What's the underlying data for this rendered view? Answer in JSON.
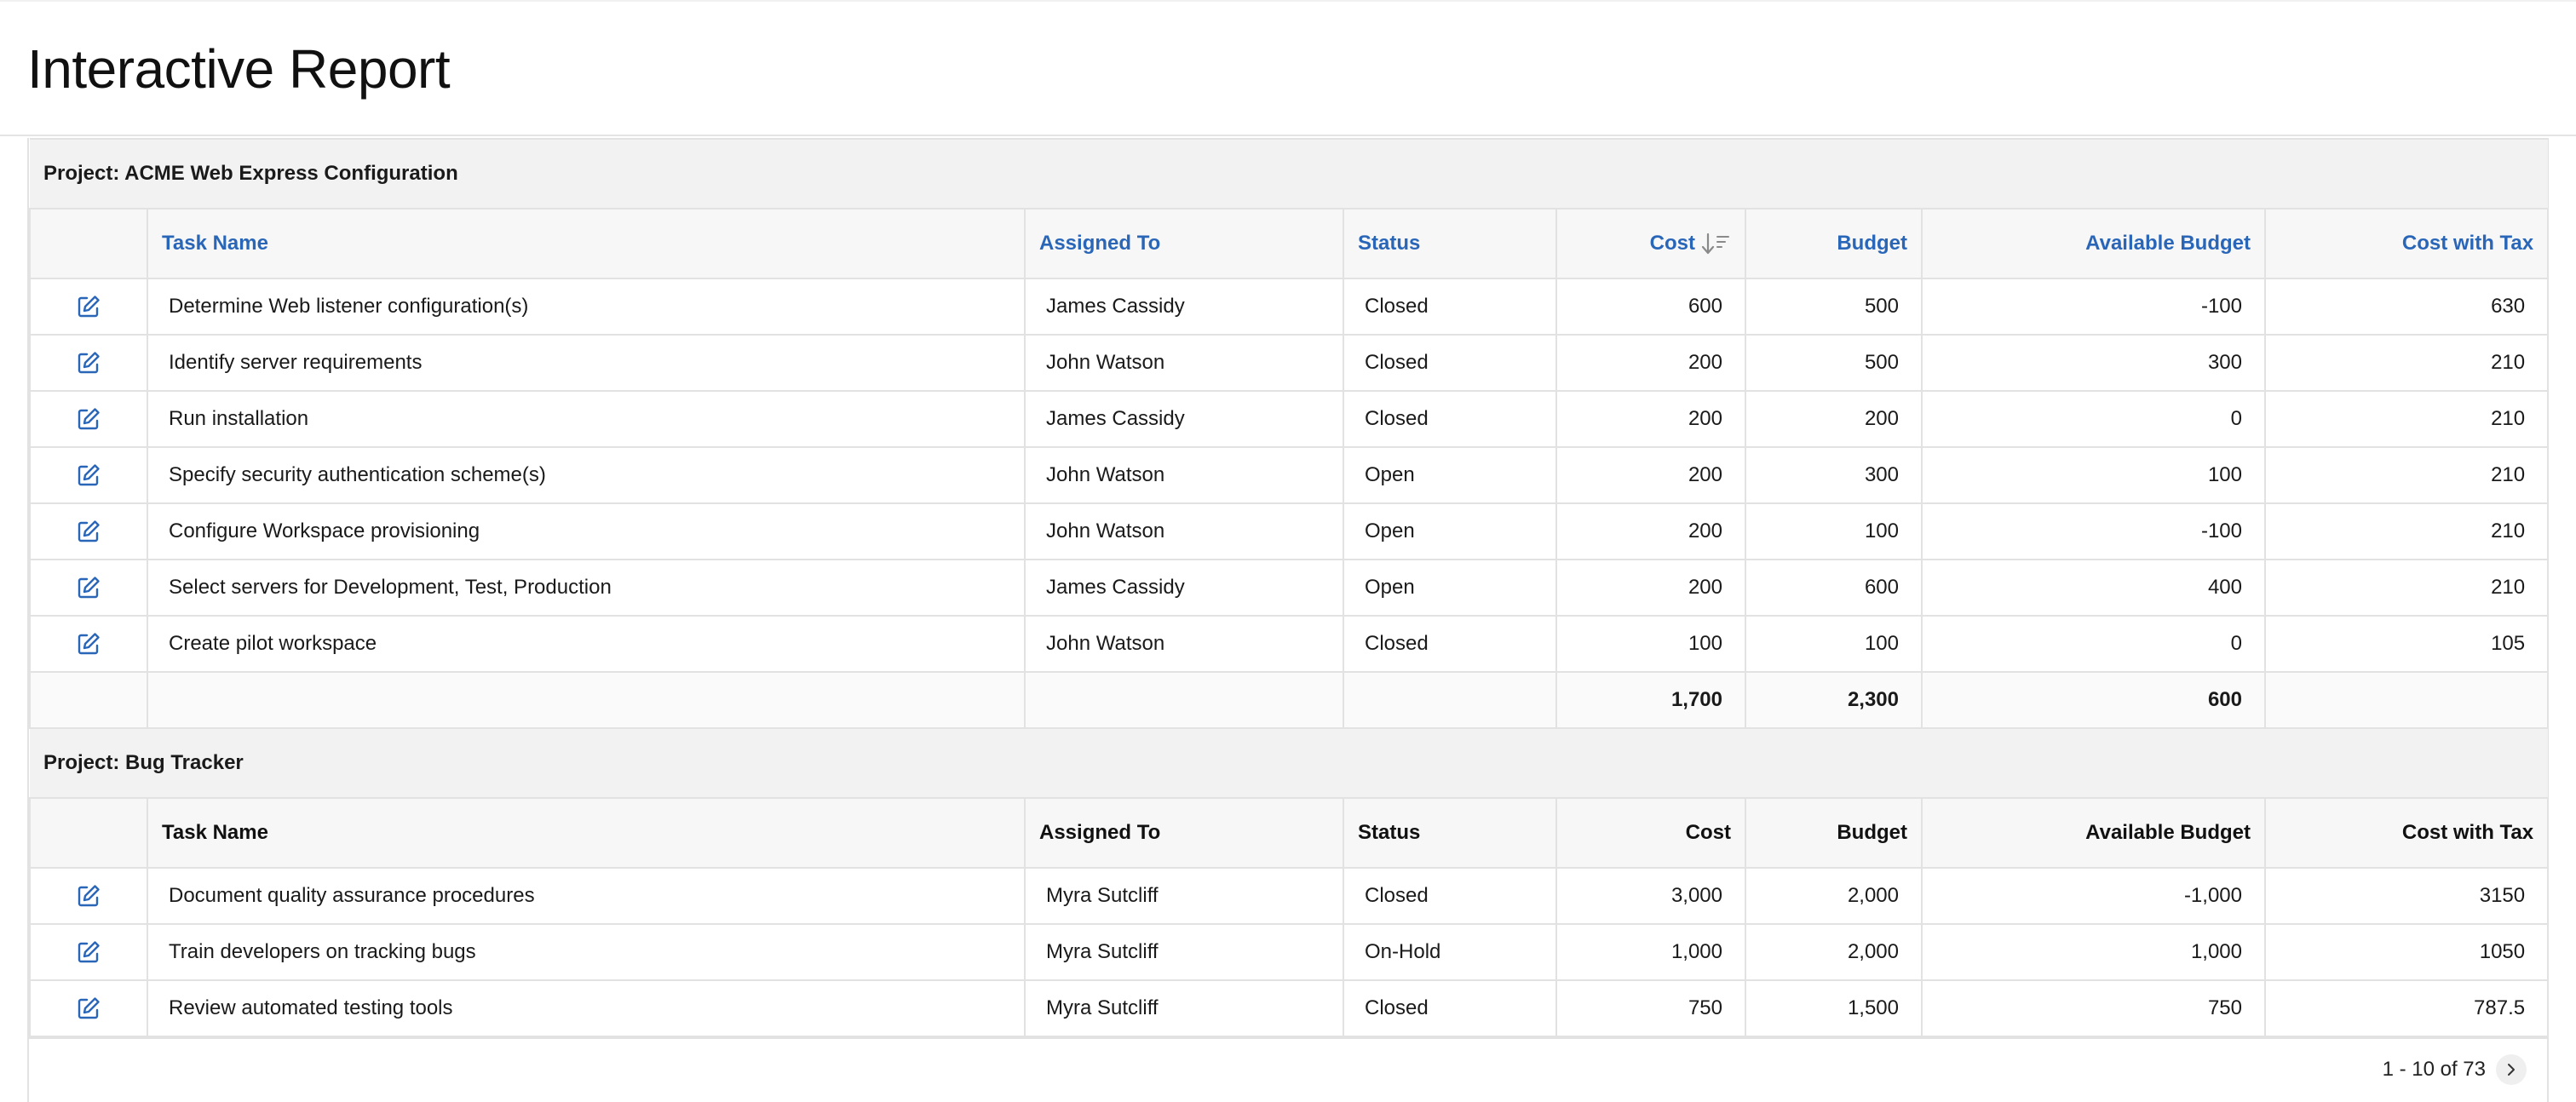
{
  "header": {
    "title": "Interactive Report"
  },
  "columns": {
    "task": "Task Name",
    "assigned": "Assigned To",
    "status": "Status",
    "cost": "Cost",
    "budget": "Budget",
    "available": "Available Budget",
    "cost_tax": "Cost with Tax"
  },
  "groups": [
    {
      "label": "Project: ACME Web Express Configuration",
      "rows": [
        {
          "task": "Determine Web listener configuration(s)",
          "assigned": "James Cassidy",
          "status": "Closed",
          "cost": "600",
          "budget": "500",
          "available": "-100",
          "cost_tax": "630"
        },
        {
          "task": "Identify server requirements",
          "assigned": "John Watson",
          "status": "Closed",
          "cost": "200",
          "budget": "500",
          "available": "300",
          "cost_tax": "210"
        },
        {
          "task": "Run installation",
          "assigned": "James Cassidy",
          "status": "Closed",
          "cost": "200",
          "budget": "200",
          "available": "0",
          "cost_tax": "210"
        },
        {
          "task": "Specify security authentication scheme(s)",
          "assigned": "John Watson",
          "status": "Open",
          "cost": "200",
          "budget": "300",
          "available": "100",
          "cost_tax": "210"
        },
        {
          "task": "Configure Workspace provisioning",
          "assigned": "John Watson",
          "status": "Open",
          "cost": "200",
          "budget": "100",
          "available": "-100",
          "cost_tax": "210"
        },
        {
          "task": "Select servers for Development, Test, Production",
          "assigned": "James Cassidy",
          "status": "Open",
          "cost": "200",
          "budget": "600",
          "available": "400",
          "cost_tax": "210"
        },
        {
          "task": "Create pilot workspace",
          "assigned": "John Watson",
          "status": "Closed",
          "cost": "100",
          "budget": "100",
          "available": "0",
          "cost_tax": "105"
        }
      ],
      "totals": {
        "cost": "1,700",
        "budget": "2,300",
        "available": "600"
      }
    },
    {
      "label": "Project: Bug Tracker",
      "rows": [
        {
          "task": "Document quality assurance procedures",
          "assigned": "Myra Sutcliff",
          "status": "Closed",
          "cost": "3,000",
          "budget": "2,000",
          "available": "-1,000",
          "cost_tax": "3150"
        },
        {
          "task": "Train developers on tracking bugs",
          "assigned": "Myra Sutcliff",
          "status": "On-Hold",
          "cost": "1,000",
          "budget": "2,000",
          "available": "1,000",
          "cost_tax": "1050"
        },
        {
          "task": "Review automated testing tools",
          "assigned": "Myra Sutcliff",
          "status": "Closed",
          "cost": "750",
          "budget": "1,500",
          "available": "750",
          "cost_tax": "787.5"
        }
      ]
    }
  ],
  "pagination": {
    "text": "1 - 10 of 73"
  },
  "colors": {
    "link": "#2a66b8",
    "group_bg": "#f2f2f2",
    "border": "#e2e2e2"
  },
  "icons": {
    "edit": "edit-icon",
    "sort": "sort-descending-icon",
    "next": "chevron-right-icon"
  }
}
